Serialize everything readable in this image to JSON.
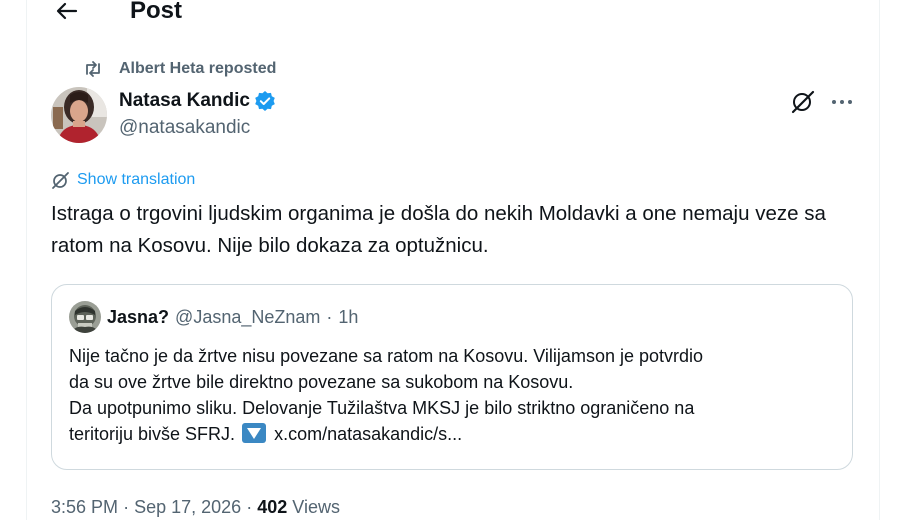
{
  "header": {
    "title": "Post"
  },
  "repost": {
    "text": "Albert Heta reposted"
  },
  "author": {
    "name": "Natasa Kandic",
    "handle": "@natasakandic"
  },
  "translate": {
    "label": "Show translation"
  },
  "post": {
    "text": "Istraga o trgovini ljudskim organima je došla do nekih Moldavki a one nemaju veze sa ratom na Kosovu. Nije bilo dokaza za optužnicu."
  },
  "quote": {
    "name": "Jasna?",
    "handle": "@Jasna_NeZnam",
    "separator": "·",
    "time": "1h",
    "lines": [
      "Nije tačno je da žrtve nisu povezane sa ratom na Kosovu. Vilijamson je potvrdio",
      "da su ove žrtve bile direktno povezane sa sukobom na Kosovu.",
      "Da upotpunimo sliku. Delovanje Tužilaštva MKSJ je bilo striktno ograničeno na"
    ],
    "last_line_text": "teritoriju bivše SFRJ.",
    "link": "x.com/natasakandic/s..."
  },
  "meta": {
    "time": "3:56 PM",
    "separator": "·",
    "date": "Sep 17, 2026",
    "views_count": "402",
    "views_label": "Views"
  },
  "colors": {
    "accent": "#1d9bf0",
    "secondary_text": "#536471",
    "border": "#cfd9de"
  },
  "icons": {
    "back": "arrow-left-icon",
    "repost": "repost-icon",
    "verified": "verified-badge-icon",
    "grok": "grok-icon",
    "more": "more-icon",
    "translate": "translate-icon"
  }
}
